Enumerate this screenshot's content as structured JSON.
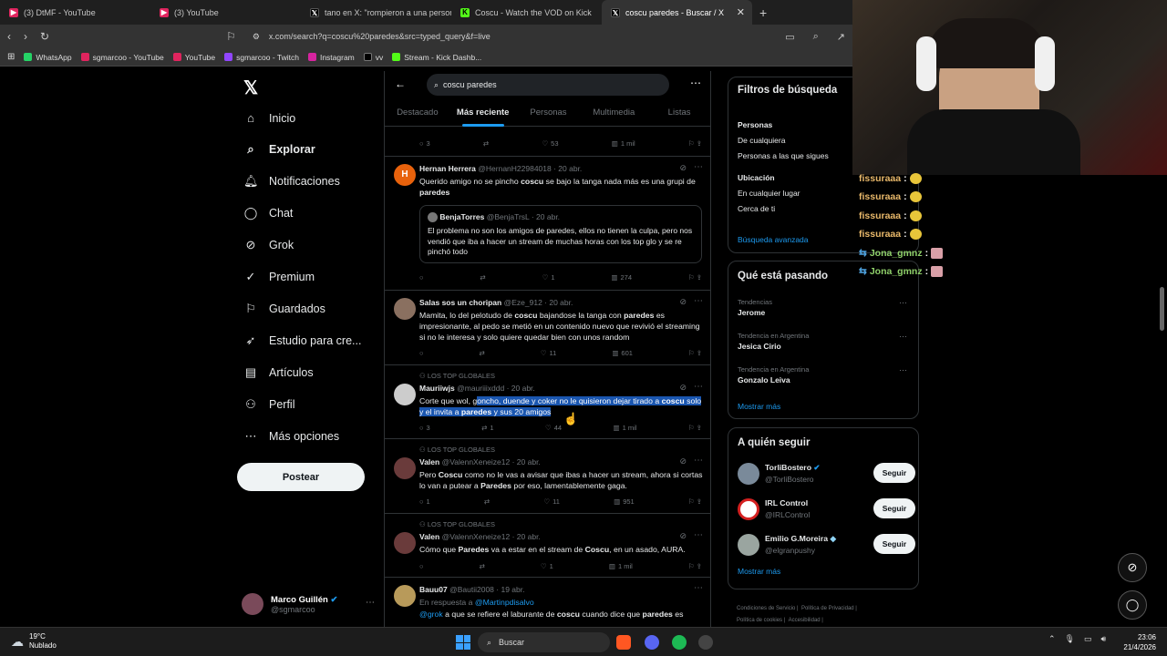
{
  "browser": {
    "tabs": [
      {
        "title": "(3) DtMF - YouTube",
        "icon": "youtube-icon"
      },
      {
        "title": "(3) YouTube",
        "icon": "youtube-icon"
      },
      {
        "title": "tano en X: \"rompieron a una persona",
        "icon": "x-icon"
      },
      {
        "title": "Coscu - Watch the VOD on Kick",
        "icon": "kick-icon"
      },
      {
        "title": "coscu paredes - Buscar / X",
        "icon": "x-icon",
        "active": true
      }
    ],
    "url": "x.com/search?q=coscu%20paredes&src=typed_query&f=live",
    "bookmarks": [
      "WhatsApp",
      "sgmarcoo - YouTube",
      "YouTube",
      "sgmarcoo - Twitch",
      "Instagram",
      "vv",
      "Stream - Kick Dashb..."
    ]
  },
  "nav": {
    "items": [
      "Inicio",
      "Explorar",
      "Notificaciones",
      "Chat",
      "Grok",
      "Premium",
      "Guardados",
      "Estudio para cre...",
      "Artículos",
      "Perfil",
      "Más opciones"
    ],
    "post_button": "Postear",
    "profile": {
      "name": "Marco Guillén",
      "handle": "@sgmarcoo"
    }
  },
  "search": {
    "query": "coscu paredes",
    "tabs": [
      "Destacado",
      "Más reciente",
      "Personas",
      "Multimedia",
      "Listas"
    ]
  },
  "posts": [
    {
      "actions": {
        "replies": "3",
        "likes": "53",
        "views": "1 mil"
      }
    },
    {
      "name": "Hernan Herrera",
      "handle": "@HernanH22984018",
      "date": "· 20 abr.",
      "text_a": "Querido amigo no se pincho ",
      "b1": "coscu",
      "text_b": " se bajo la tanga nada más es una grupi de ",
      "b2": "paredes",
      "quote": {
        "name": "BenjaTorres",
        "handle": "@BenjaTrsL",
        "date": "· 20 abr.",
        "text": "El problema no son los amigos de paredes, ellos no tienen la culpa, pero nos vendió que iba a hacer un stream de muchas horas con los top glo y se re pinchó todo"
      },
      "actions": {
        "replies": "",
        "likes": "1",
        "views": "274"
      }
    },
    {
      "name": "Salas sos un choripan",
      "handle": "@Eze_912",
      "date": "· 20 abr.",
      "text_a": "Mamita, lo del pelotudo de ",
      "b1": "coscu",
      "text_b": " bajandose la tanga con ",
      "b2": "paredes",
      "text_c": " es impresionante, al pedo se metió en un contenido nuevo que revivió el streaming si no le interesa y solo quiere quedar bien con unos random",
      "actions": {
        "replies": "",
        "likes": "11",
        "views": "601"
      }
    },
    {
      "context": "LOS TOP GLOBALES",
      "name": "Mauriiwjs",
      "handle": "@mauriiixddd",
      "date": "· 20 abr.",
      "text_a": "Corte que wol, g",
      "hl_a": "oncho, duende y coker no le quisieron dejar tirado a ",
      "b1": "coscu",
      "hl_b": " solo y el invita a ",
      "b2": "paredes",
      "hl_c": " y sus 20 amigos",
      "actions": {
        "replies": "3",
        "reposts": "1",
        "likes": "44",
        "views": "1 mil"
      }
    },
    {
      "context": "LOS TOP GLOBALES",
      "name": "Valen",
      "handle": "@ValennXeneize12",
      "date": "· 20 abr.",
      "text_a": "Pero ",
      "b1": "Coscu",
      "text_b": " como no le vas a avisar que ibas a hacer un stream, ahora si cortas lo van a putear a ",
      "b2": "Paredes",
      "text_c": " por eso, lamentablemente gaga.",
      "actions": {
        "replies": "1",
        "likes": "11",
        "views": "951"
      }
    },
    {
      "context": "LOS TOP GLOBALES",
      "name": "Valen",
      "handle": "@ValennXeneize12",
      "date": "· 20 abr.",
      "text_a": "Cómo que ",
      "b1": "Paredes",
      "text_b": " va a estar en el stream de ",
      "b2": "Coscu",
      "text_c": ", en un asado, AURA.",
      "actions": {
        "replies": "",
        "likes": "1",
        "views": "1 mil"
      }
    },
    {
      "name": "Bauu07",
      "handle": "@Bautii2008",
      "date": "· 19 abr.",
      "reply_to_label": "En respuesta a ",
      "reply_to": "@Martinpdisalvo",
      "mention": "@grok",
      "text_a": " a que se refiere el laburante de ",
      "b1": "coscu",
      "text_b": " cuando dice que ",
      "b2": "paredes",
      "text_c": " es"
    }
  ],
  "filters": {
    "title": "Filtros de búsqueda",
    "people_label": "Personas",
    "people_opts": [
      "De cualquiera",
      "Personas a las que sigues"
    ],
    "location_label": "Ubicación",
    "location_opts": [
      "En cualquier lugar",
      "Cerca de ti"
    ],
    "advanced": "Búsqueda avanzada"
  },
  "trends": {
    "title": "Qué está pasando",
    "items": [
      {
        "context": "Tendencias",
        "name": "Jerome"
      },
      {
        "context": "Tendencia en Argentina",
        "name": "Jesica Cirio"
      },
      {
        "context": "Tendencia en Argentina",
        "name": "Gonzalo Leiva"
      }
    ],
    "more": "Mostrar más"
  },
  "who_to_follow": {
    "title": "A quién seguir",
    "items": [
      {
        "name": "TorliBostero",
        "handle": "@TorliBostero",
        "verified": "blue"
      },
      {
        "name": "IRL Control",
        "handle": "@IRLControl"
      },
      {
        "name": "Emilio G.Moreira",
        "handle": "@elgranpushy",
        "verified": "diamond"
      }
    ],
    "follow_label": "Seguir",
    "more": "Mostrar más"
  },
  "footer": [
    "Condiciones de Servicio",
    "Política de Privacidad",
    "Política de cookies",
    "Accesibilidad"
  ],
  "stream_chat": [
    {
      "user": "fissuraaa",
      "color": "#e8b86a"
    },
    {
      "user": "fissuraaa",
      "color": "#e8b86a"
    },
    {
      "user": "fissuraaa",
      "color": "#e8b86a"
    },
    {
      "user": "fissuraaa",
      "color": "#e8b86a"
    },
    {
      "user": "Jona_gmnz",
      "color": "#8fd06a"
    },
    {
      "user": "Jona_gmnz",
      "color": "#8fd06a"
    }
  ],
  "taskbar": {
    "weather_temp": "19°C",
    "weather_desc": "Nublado",
    "search": "Buscar",
    "time": "23:06",
    "date": "21/4/2026"
  },
  "colors": {
    "accent": "#1d9bf0",
    "highlight": "#1a56b0",
    "background": "#000000"
  }
}
